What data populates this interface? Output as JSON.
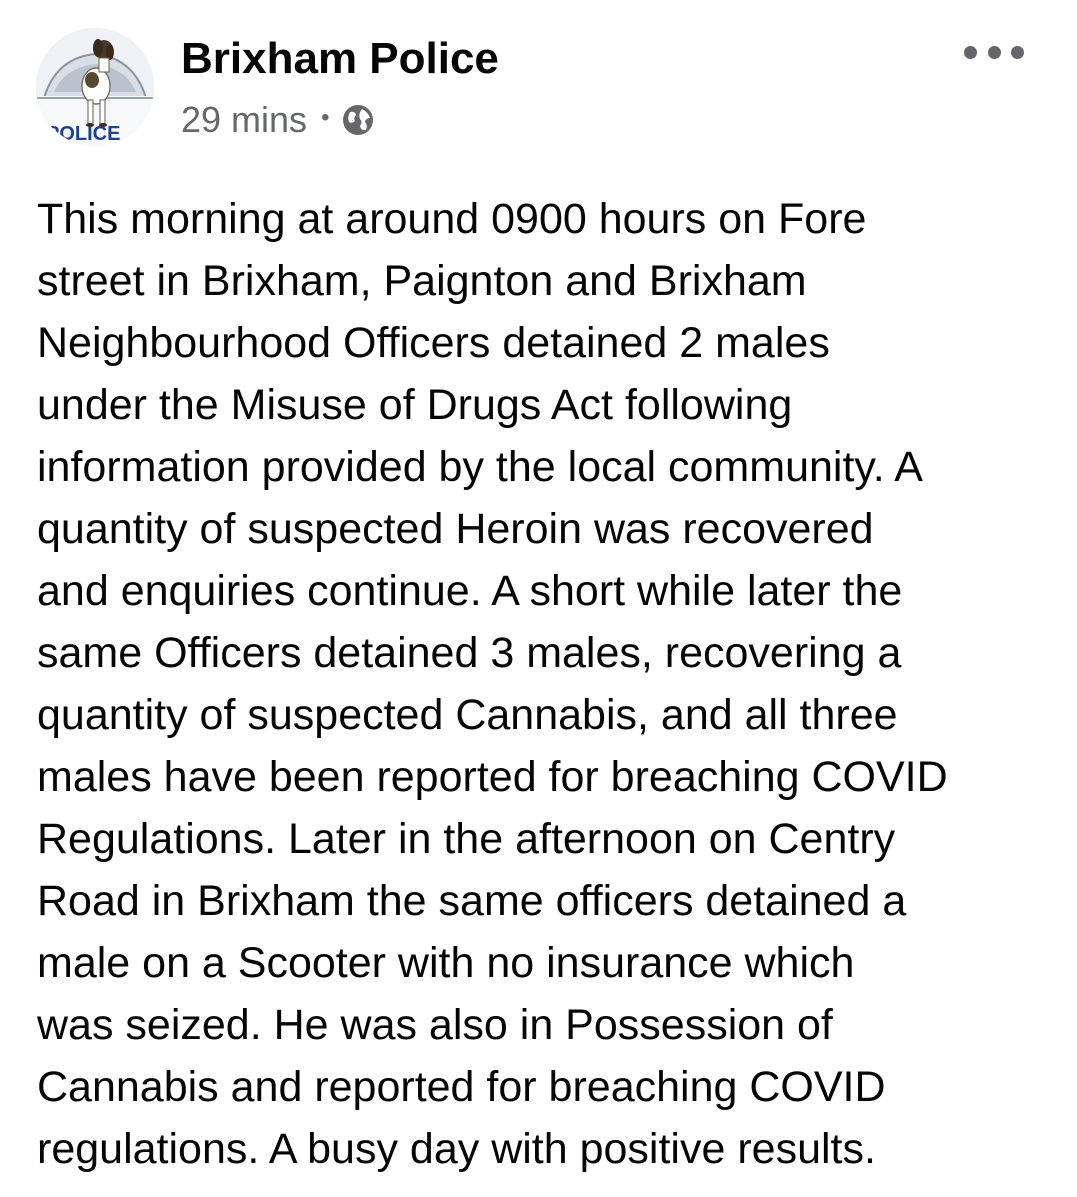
{
  "post": {
    "author": "Brixham Police",
    "timestamp": "29 mins",
    "separator": "•",
    "privacy_icon": "globe-icon",
    "menu_icon": "more-options-icon",
    "avatar": {
      "badge_text": "POLICE",
      "description_icon": "police-dog-avatar"
    },
    "body_lines": [
      "This morning at around 0900 hours on Fore",
      "street in Brixham, Paignton and Brixham",
      "Neighbourhood Officers detained 2 males",
      "under the Misuse of Drugs Act following",
      "information provided by the local community. A",
      "quantity of suspected Heroin was recovered",
      "and enquiries continue. A short while later the",
      "same Officers detained 3 males, recovering a",
      "quantity of suspected Cannabis, and all three",
      "males have been reported for breaching COVID",
      "Regulations. Later in the afternoon on Centry",
      "Road in Brixham the same officers detained a",
      "male on a Scooter with no insurance which",
      "was seized. He was also in Possession of",
      "Cannabis and reported for breaching COVID",
      "regulations. A busy day with positive results."
    ]
  },
  "colors": {
    "text_primary": "#050505",
    "text_secondary": "#65676b",
    "background": "#ffffff",
    "police_blue": "#1f3f8f"
  }
}
